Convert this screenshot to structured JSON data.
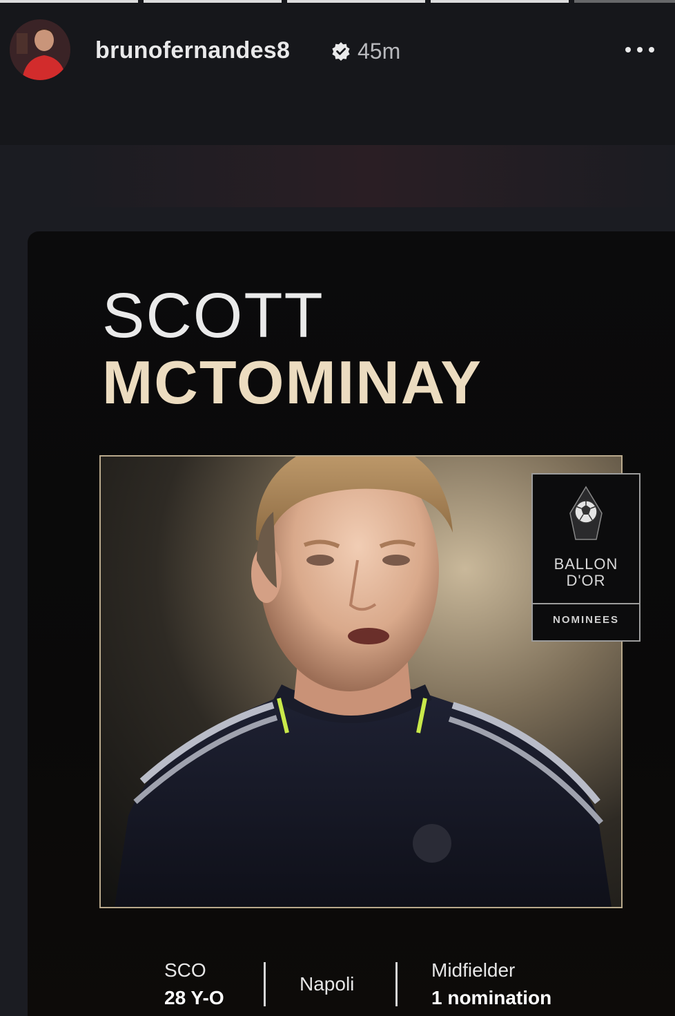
{
  "story": {
    "progress_segments": [
      {
        "state": "done"
      },
      {
        "state": "done"
      },
      {
        "state": "done"
      },
      {
        "state": "active"
      },
      {
        "state": "pending"
      }
    ]
  },
  "header": {
    "username": "brunofernandes8",
    "timestamp": "45m",
    "verified_icon": "verified-badge-icon",
    "more_icon": "more-options-icon"
  },
  "card": {
    "first_name": "SCOTT",
    "last_name": "MCTOMINAY",
    "badge": {
      "line1": "BALLON",
      "line2": "D'OR",
      "label": "NOMINEES",
      "icon": "ballon-dor-trophy-icon"
    },
    "info": {
      "country": "SCO",
      "age": "28 Y-O",
      "club": "Napoli",
      "position": "Midfielder",
      "nominations": "1 nomination"
    },
    "colors": {
      "name_accent": "#ecdcc0",
      "frame_border": "#b9a98c",
      "background": "#0b0b0c"
    }
  }
}
